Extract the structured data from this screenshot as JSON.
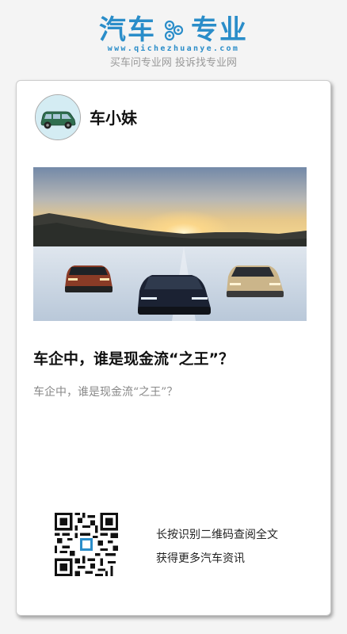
{
  "header": {
    "logo_left": "汽车",
    "logo_right": "专业",
    "url": "www.qichezhuanye.com",
    "slogan": "买车问专业网 投诉找专业网"
  },
  "card": {
    "author_name": "车小妹",
    "article_title": "车企中，谁是现金流“之王”？",
    "article_summary": "车企中，谁是现金流“之王”？",
    "cta_line1": "长按识别二维码查阅全文",
    "cta_line2": "获得更多汽车资讯"
  },
  "colors": {
    "brand": "#2a8dc9",
    "card_bg": "#ffffff",
    "page_bg": "#f4f4f4"
  }
}
